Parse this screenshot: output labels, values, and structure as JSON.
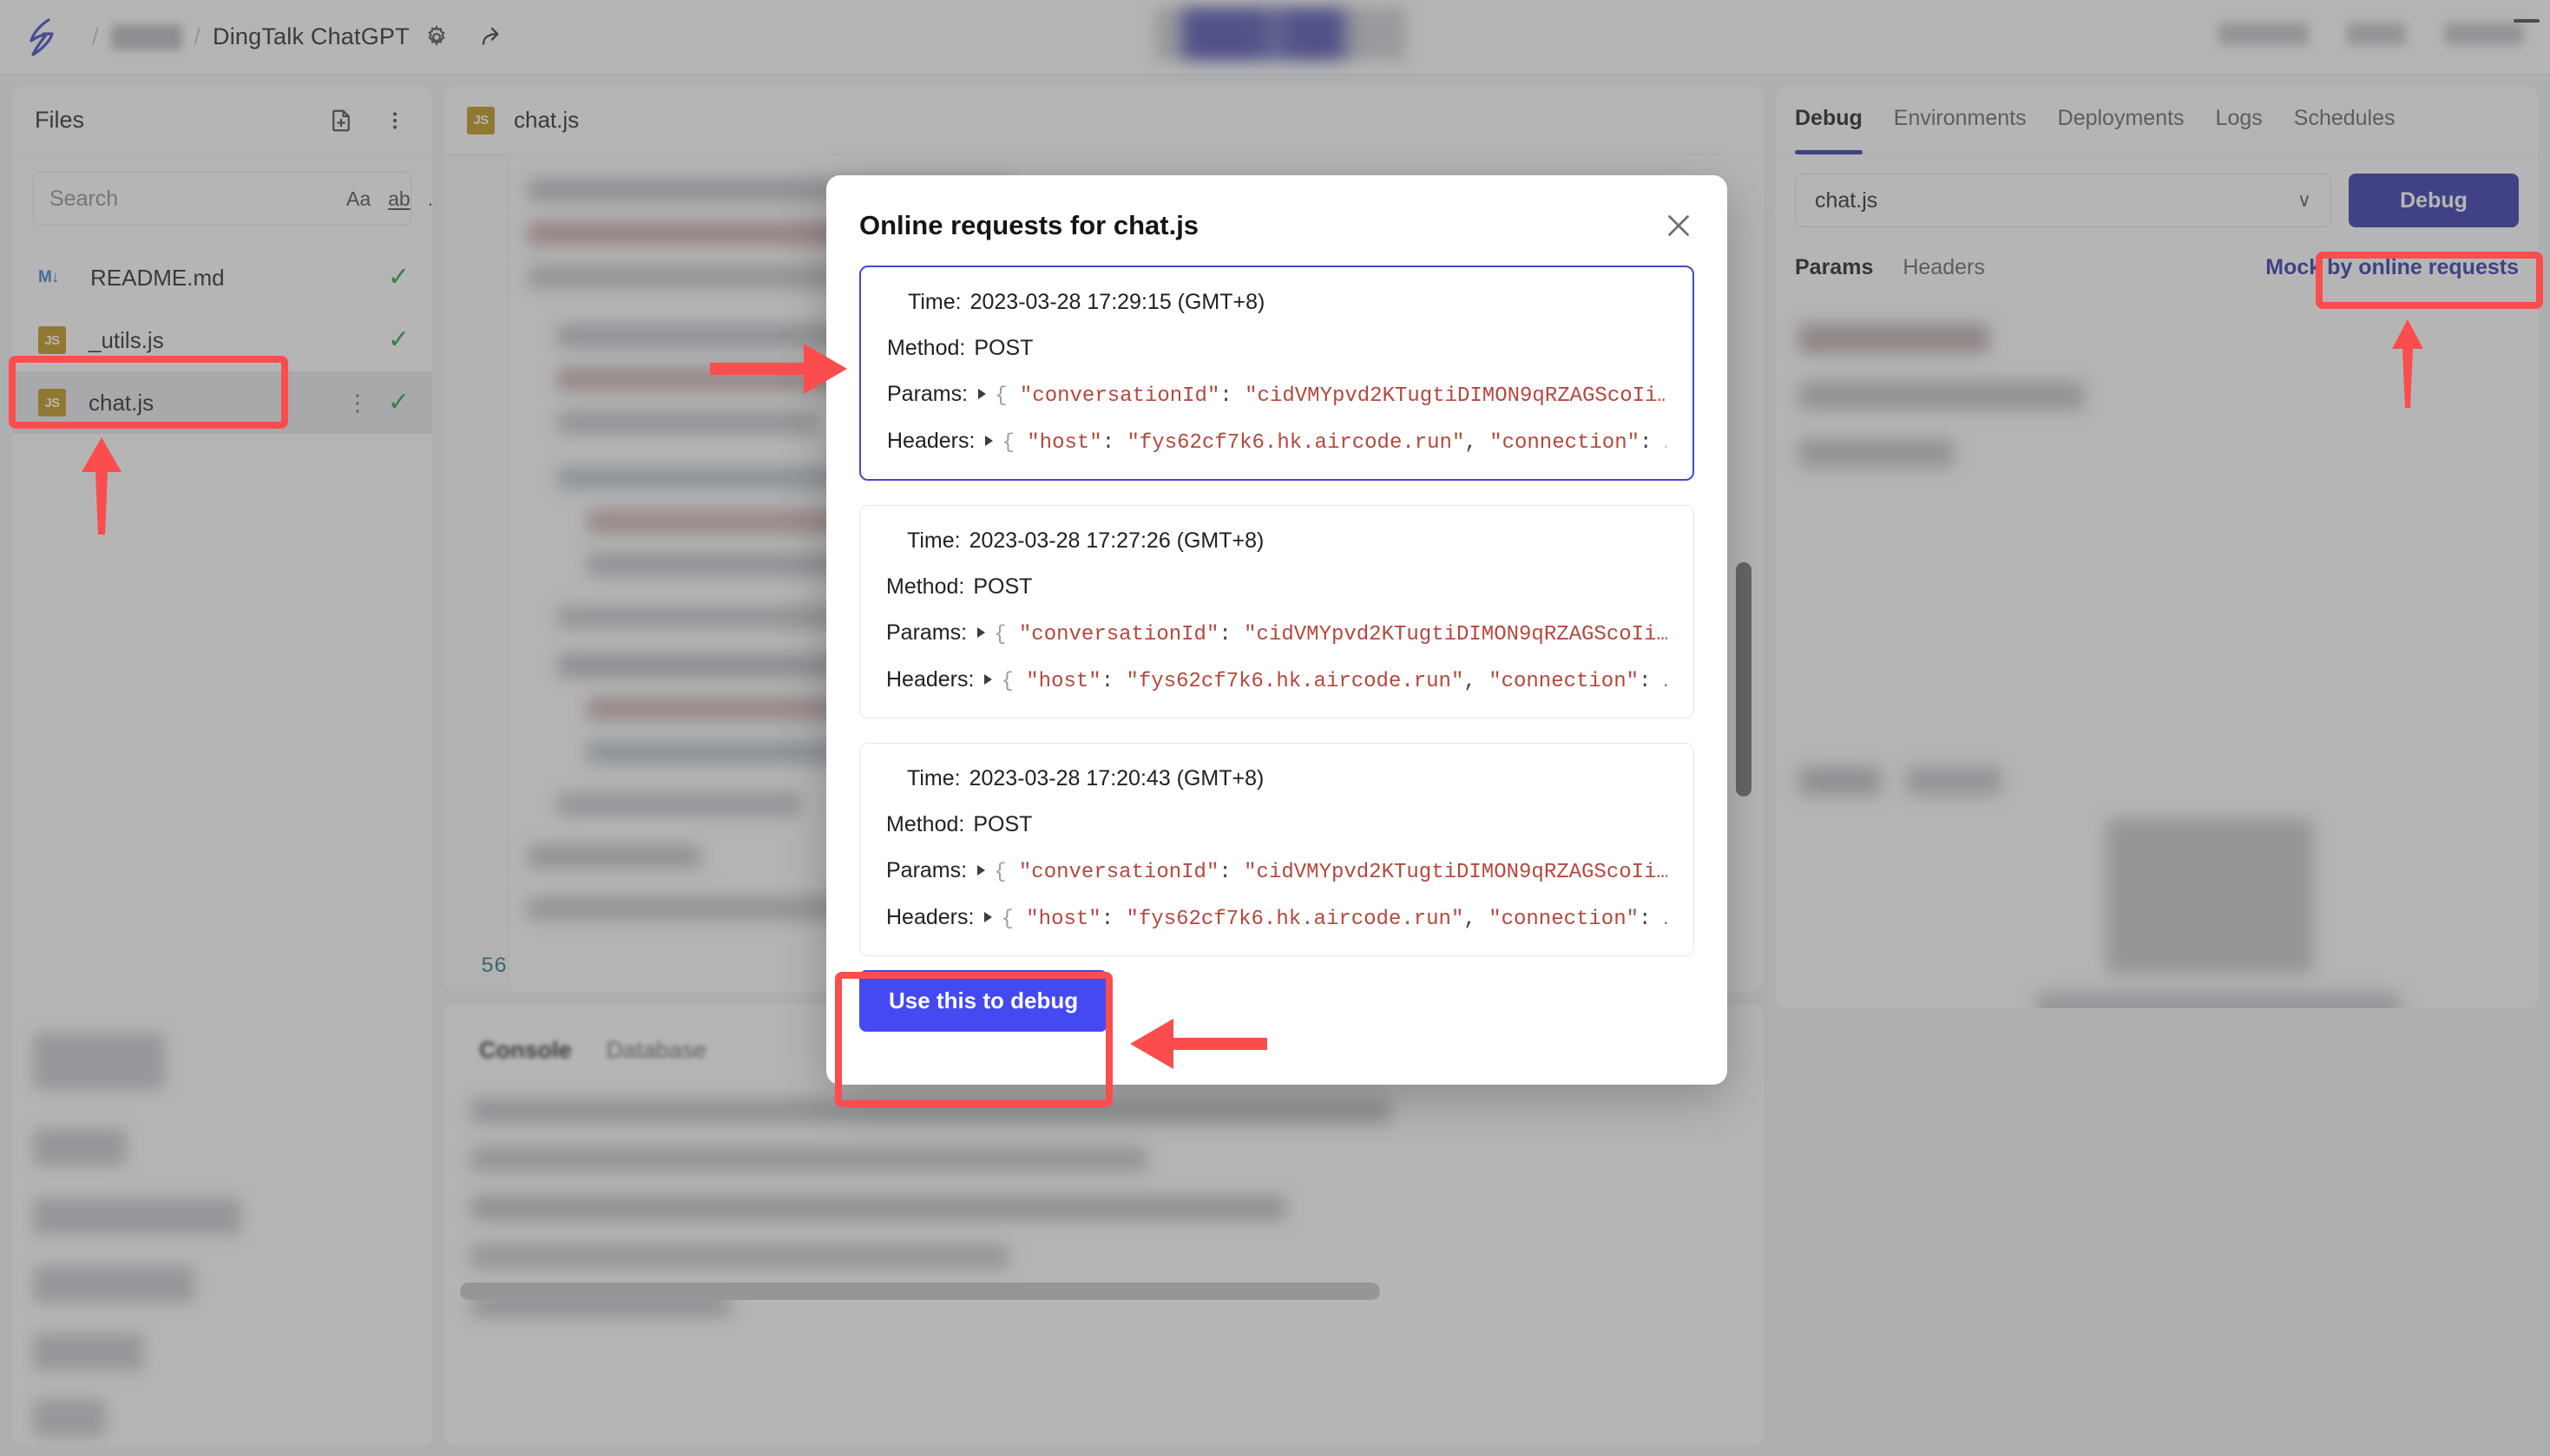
{
  "topbar": {
    "breadcrumb_separator": "/",
    "project_title": "DingTalk ChatGPT",
    "gear_icon": "gear-icon",
    "share_icon": "share-icon"
  },
  "sidebar": {
    "title": "Files",
    "new_file_icon": "new-file-icon",
    "more_icon": "kebab-menu-icon",
    "search": {
      "placeholder": "Search",
      "value": "",
      "tools": [
        {
          "name": "match-case",
          "label": "Aa"
        },
        {
          "name": "match-whole-word",
          "label": "ab"
        },
        {
          "name": "use-regex",
          "label": ".*"
        }
      ]
    },
    "files": [
      {
        "name": "README.md",
        "icon": "markdown-icon",
        "icon_label": "M↓",
        "selected": false,
        "saved": true
      },
      {
        "name": "_utils.js",
        "icon": "js-icon",
        "icon_label": "JS",
        "selected": false,
        "saved": true
      },
      {
        "name": "chat.js",
        "icon": "js-icon",
        "icon_label": "JS",
        "selected": true,
        "saved": true
      }
    ],
    "check_mark": "✓",
    "kebab": "⋮"
  },
  "editor": {
    "tab": {
      "label": "chat.js",
      "icon": "js-icon",
      "icon_label": "JS"
    },
    "last_line_number": "56"
  },
  "console": {
    "tabs": [
      {
        "label": "Console",
        "active": true
      },
      {
        "label": "Database",
        "active": false
      }
    ]
  },
  "right_panel": {
    "tabs": [
      {
        "label": "Debug",
        "active": true
      },
      {
        "label": "Environments",
        "active": false
      },
      {
        "label": "Deployments",
        "active": false
      },
      {
        "label": "Logs",
        "active": false
      },
      {
        "label": "Schedules",
        "active": false
      }
    ],
    "file_select": {
      "value": "chat.js",
      "chevron": "∨"
    },
    "debug_button": "Debug",
    "sub_tabs": [
      {
        "label": "Params",
        "active": true
      },
      {
        "label": "Headers",
        "active": false
      }
    ],
    "mock_link": "Mock by online requests"
  },
  "modal": {
    "title": "Online requests for chat.js",
    "close_icon": "close-icon",
    "labels": {
      "time": "Time:",
      "method": "Method:",
      "params": "Params:",
      "headers": "Headers:"
    },
    "requests": [
      {
        "time": "2023-03-28 17:29:15 (GMT+8)",
        "method": "POST",
        "params_key": "\"conversationId\"",
        "params_value": "\"cidVMYpvd2KTugtiDIMON9qRZAGScoIi…",
        "headers_key": "\"host\"",
        "headers_value": "\"fys62cf7k6.hk.aircode.run\"",
        "headers_next_key": "\"connection\"",
        "selected": true
      },
      {
        "time": "2023-03-28 17:27:26 (GMT+8)",
        "method": "POST",
        "params_key": "\"conversationId\"",
        "params_value": "\"cidVMYpvd2KTugtiDIMON9qRZAGScoIi…",
        "headers_key": "\"host\"",
        "headers_value": "\"fys62cf7k6.hk.aircode.run\"",
        "headers_next_key": "\"connection\"",
        "selected": false
      },
      {
        "time": "2023-03-28 17:20:43 (GMT+8)",
        "method": "POST",
        "params_key": "\"conversationId\"",
        "params_value": "\"cidVMYpvd2KTugtiDIMON9qRZAGScoIi…",
        "headers_key": "\"host\"",
        "headers_value": "\"fys62cf7k6.hk.aircode.run\"",
        "headers_next_key": "\"connection\"",
        "selected": false
      }
    ],
    "use_debug_button": "Use this to debug"
  },
  "annotations": {
    "color": "#fb4d4d",
    "items": [
      {
        "name": "highlight-chat-js-file",
        "type": "box"
      },
      {
        "name": "arrow-to-chat-js-file",
        "type": "arrow-up"
      },
      {
        "name": "arrow-to-selected-request",
        "type": "arrow-right"
      },
      {
        "name": "highlight-mock-by-online-requests",
        "type": "box"
      },
      {
        "name": "arrow-to-mock-link",
        "type": "arrow-up"
      },
      {
        "name": "highlight-use-this-to-debug",
        "type": "box"
      },
      {
        "name": "arrow-to-use-this-to-debug",
        "type": "arrow-left"
      }
    ]
  }
}
